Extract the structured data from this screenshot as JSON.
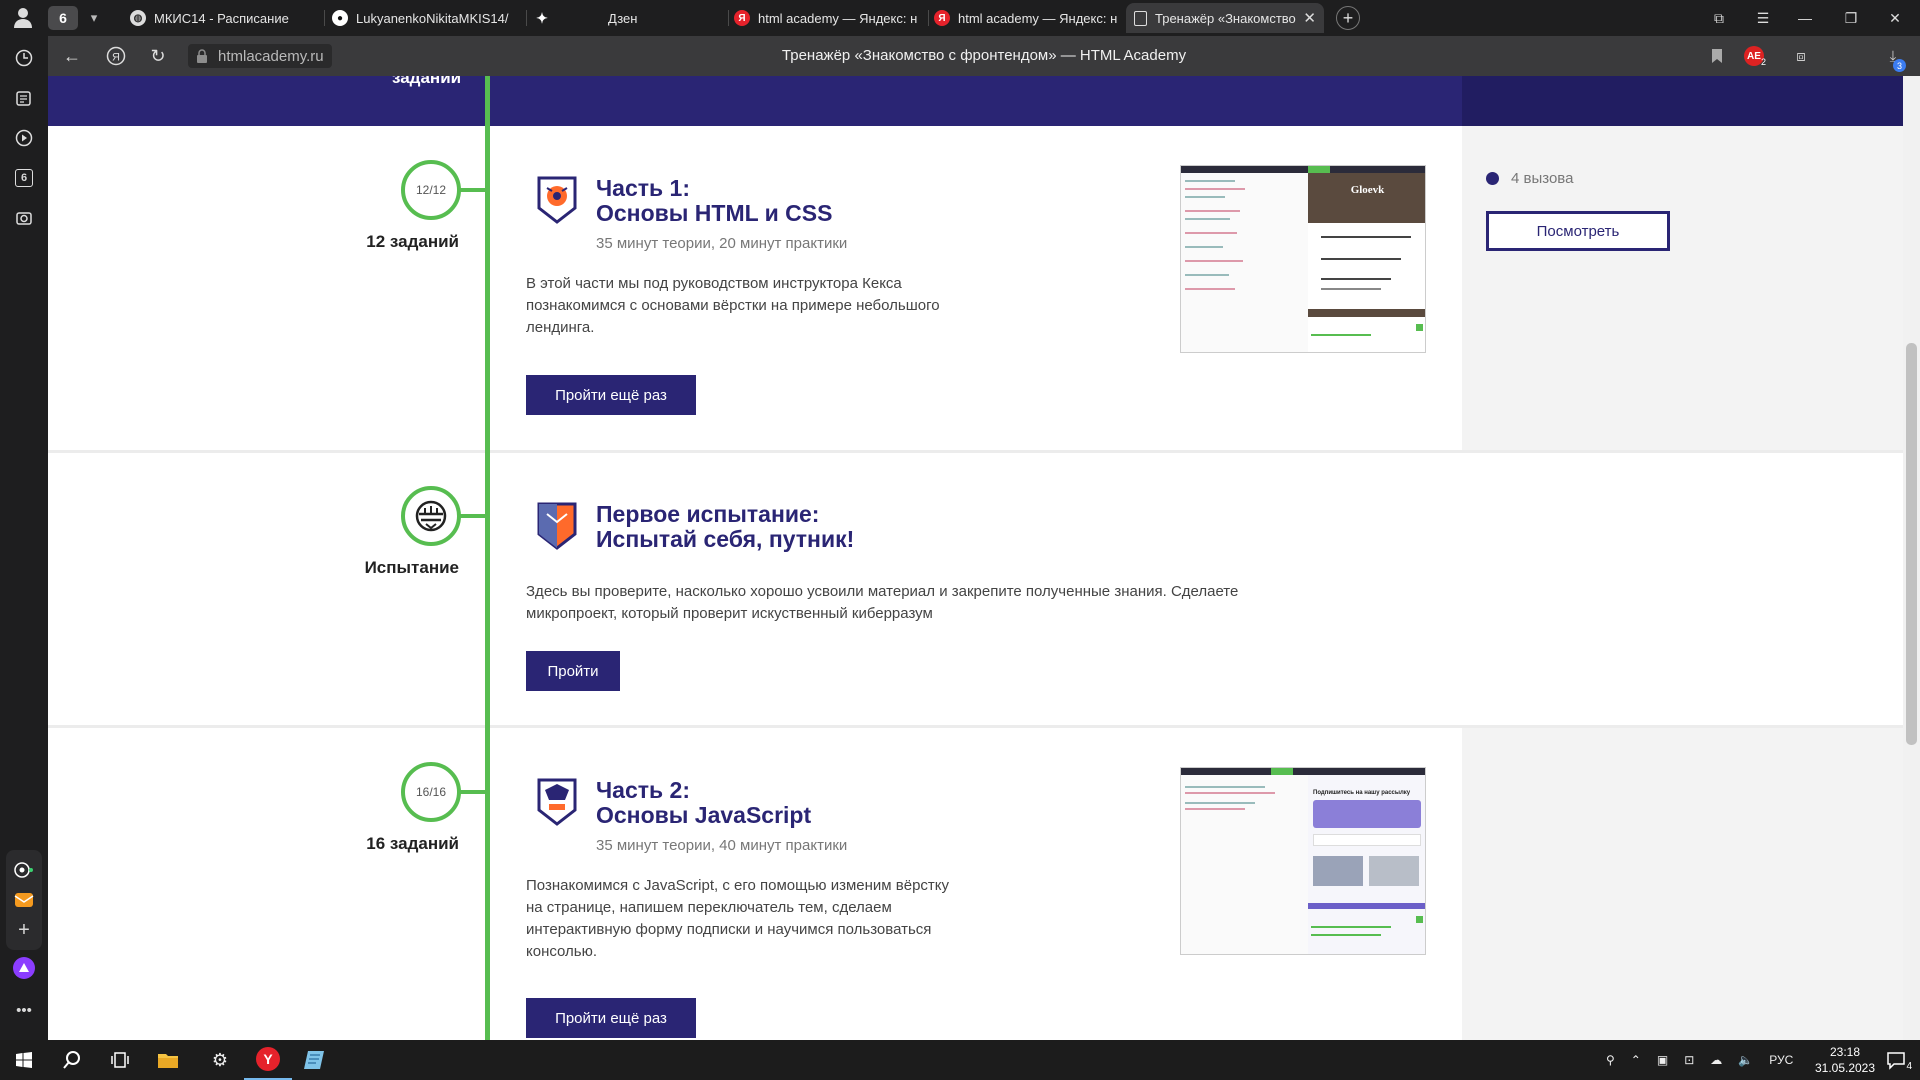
{
  "browser": {
    "tab_count": "6",
    "tabs": [
      {
        "label": "МКИС14 - Расписание",
        "favicon": "globe-icon"
      },
      {
        "label": "LukyanenkoNikitaMKIS14/",
        "favicon": "github-icon"
      },
      {
        "label": "Дзен",
        "favicon": "dzen-icon"
      },
      {
        "label": "html academy — Яндекс: н",
        "favicon": "yandex-icon"
      },
      {
        "label": "html academy — Яндекс: н",
        "favicon": "yandex-icon"
      },
      {
        "label": "Тренажёр «Знакомство",
        "favicon": "shield-icon"
      }
    ],
    "url": "htmlacademy.ru",
    "page_title": "Тренажёр «Знакомство с фронтендом» — HTML Academy",
    "ae_badge": "AE",
    "ae_badge_count": "2",
    "downloads_count": "3",
    "sidebar_badge": "6"
  },
  "page": {
    "top_label": "заданий",
    "sections": [
      {
        "node": "12/12",
        "count_label": "12 заданий",
        "title_line1": "Часть 1:",
        "title_line2": "Основы HTML и CSS",
        "time": "35 минут теории, 20 минут практики",
        "desc": [
          "В этой части мы под руководством инструктора Кекса",
          "познакомимся с основами вёрстки на примере небольшого",
          "лендинга."
        ],
        "button": "Пройти ещё раз",
        "thumb_heading": "Gloevk"
      },
      {
        "node": "",
        "count_label": "Испытание",
        "title_line1": "Первое испытание:",
        "title_line2": "Испытай себя, путник!",
        "time": "",
        "desc": [
          "Здесь вы проверите, насколько хорошо усвоили материал и закрепите полученные знания. Сделаете",
          "микропроект, который проверит искуственный киберразум"
        ],
        "button": "Пройти"
      },
      {
        "node": "16/16",
        "count_label": "16 заданий",
        "title_line1": "Часть 2:",
        "title_line2": "Основы JavaScript",
        "time": "35 минут теории, 40 минут практики",
        "desc": [
          "Познакомимся с JavaScript, с его помощью изменим вёрстку",
          "на странице, напишем переключатель тем, сделаем",
          "интерактивную форму подписки и научимся пользоваться",
          "консолью."
        ],
        "button": "Пройти ещё раз",
        "thumb_heading": "Подпишитесь на нашу рассылку"
      }
    ],
    "challenges": {
      "text": "4 вызова",
      "button": "Посмотреть"
    }
  },
  "taskbar": {
    "lang": "РУС",
    "time": "23:18",
    "date": "31.05.2023",
    "notifications": "4"
  },
  "colors": {
    "brand": "#2a2574",
    "timeline": "#57bd50"
  }
}
